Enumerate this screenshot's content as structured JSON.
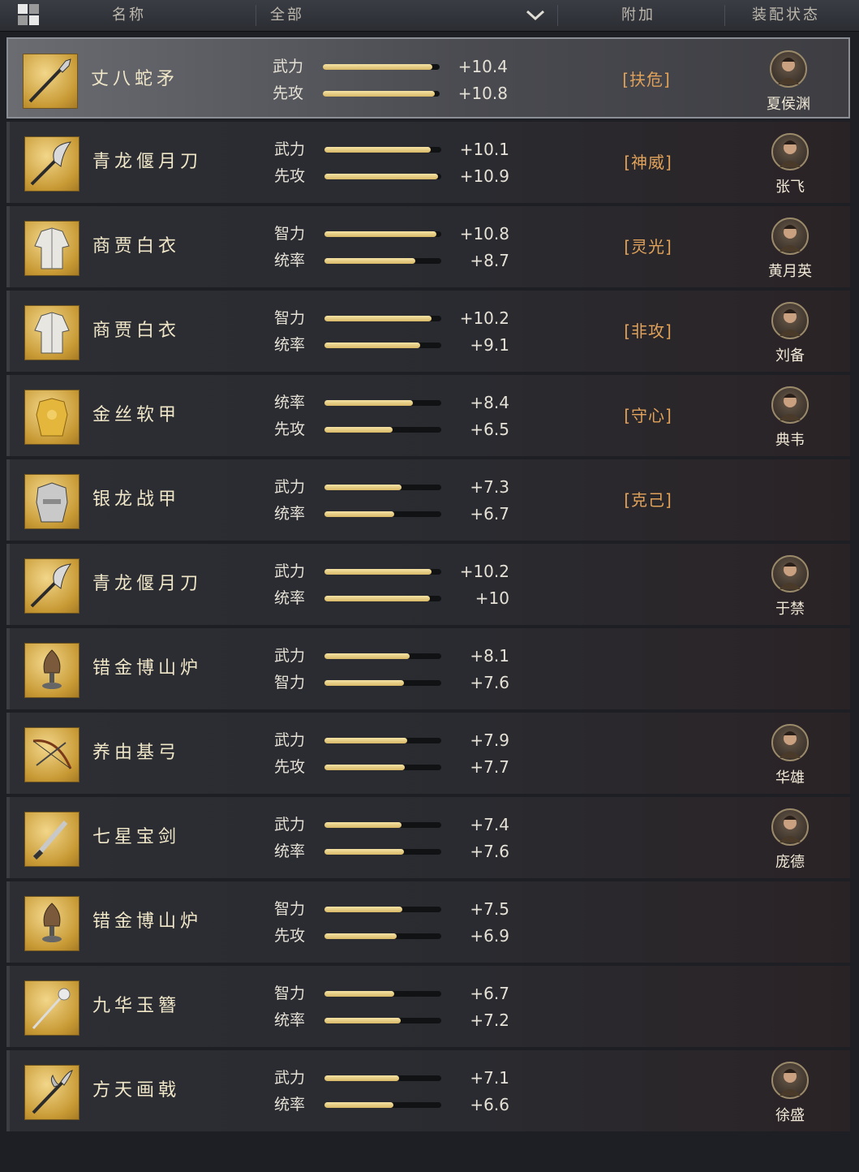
{
  "header": {
    "name_label": "名称",
    "filter_value": "全部",
    "bonus_label": "附加",
    "status_label": "装配状态"
  },
  "colors": {
    "accent_gold": "#d8b866",
    "bonus_orange": "#e0a25a",
    "row_bg": "#2c2e34",
    "selected_bg": "#6a6c72"
  },
  "items": [
    {
      "name": "丈八蛇矛",
      "icon": "serpent-spear-icon",
      "stats": [
        {
          "label": "武力",
          "value": "+10.4",
          "fill": 0.94
        },
        {
          "label": "先攻",
          "value": "+10.8",
          "fill": 0.96
        }
      ],
      "bonus": "[扶危]",
      "hero": "夏侯渊",
      "selected": true
    },
    {
      "name": "青龙偃月刀",
      "icon": "crescent-blade-icon",
      "stats": [
        {
          "label": "武力",
          "value": "+10.1",
          "fill": 0.91
        },
        {
          "label": "先攻",
          "value": "+10.9",
          "fill": 0.97
        }
      ],
      "bonus": "[神威]",
      "hero": "张飞",
      "selected": false
    },
    {
      "name": "商贾白衣",
      "icon": "white-robe-icon",
      "stats": [
        {
          "label": "智力",
          "value": "+10.8",
          "fill": 0.96
        },
        {
          "label": "统率",
          "value": "+8.7",
          "fill": 0.78
        }
      ],
      "bonus": "[灵光]",
      "hero": "黄月英",
      "selected": false
    },
    {
      "name": "商贾白衣",
      "icon": "white-robe-icon",
      "stats": [
        {
          "label": "智力",
          "value": "+10.2",
          "fill": 0.92
        },
        {
          "label": "统率",
          "value": "+9.1",
          "fill": 0.82
        }
      ],
      "bonus": "[非攻]",
      "hero": "刘备",
      "selected": false
    },
    {
      "name": "金丝软甲",
      "icon": "gold-armor-icon",
      "stats": [
        {
          "label": "统率",
          "value": "+8.4",
          "fill": 0.76
        },
        {
          "label": "先攻",
          "value": "+6.5",
          "fill": 0.58
        }
      ],
      "bonus": "[守心]",
      "hero": "典韦",
      "selected": false
    },
    {
      "name": "银龙战甲",
      "icon": "silver-armor-icon",
      "stats": [
        {
          "label": "武力",
          "value": "+7.3",
          "fill": 0.66
        },
        {
          "label": "统率",
          "value": "+6.7",
          "fill": 0.6
        }
      ],
      "bonus": "[克己]",
      "hero": "",
      "selected": false
    },
    {
      "name": "青龙偃月刀",
      "icon": "crescent-blade-icon",
      "stats": [
        {
          "label": "武力",
          "value": "+10.2",
          "fill": 0.92
        },
        {
          "label": "统率",
          "value": "+10",
          "fill": 0.9
        }
      ],
      "bonus": "",
      "hero": "于禁",
      "selected": false
    },
    {
      "name": "错金博山炉",
      "icon": "incense-burner-icon",
      "stats": [
        {
          "label": "武力",
          "value": "+8.1",
          "fill": 0.73
        },
        {
          "label": "智力",
          "value": "+7.6",
          "fill": 0.68
        }
      ],
      "bonus": "",
      "hero": "",
      "selected": false
    },
    {
      "name": "养由基弓",
      "icon": "bow-icon",
      "stats": [
        {
          "label": "武力",
          "value": "+7.9",
          "fill": 0.71
        },
        {
          "label": "先攻",
          "value": "+7.7",
          "fill": 0.69
        }
      ],
      "bonus": "",
      "hero": "华雄",
      "selected": false
    },
    {
      "name": "七星宝剑",
      "icon": "sword-icon",
      "stats": [
        {
          "label": "武力",
          "value": "+7.4",
          "fill": 0.66
        },
        {
          "label": "统率",
          "value": "+7.6",
          "fill": 0.68
        }
      ],
      "bonus": "",
      "hero": "庞德",
      "selected": false
    },
    {
      "name": "错金博山炉",
      "icon": "incense-burner-icon",
      "stats": [
        {
          "label": "智力",
          "value": "+7.5",
          "fill": 0.67
        },
        {
          "label": "先攻",
          "value": "+6.9",
          "fill": 0.62
        }
      ],
      "bonus": "",
      "hero": "",
      "selected": false
    },
    {
      "name": "九华玉簪",
      "icon": "jade-hairpin-icon",
      "stats": [
        {
          "label": "智力",
          "value": "+6.7",
          "fill": 0.6
        },
        {
          "label": "统率",
          "value": "+7.2",
          "fill": 0.65
        }
      ],
      "bonus": "",
      "hero": "",
      "selected": false
    },
    {
      "name": "方天画戟",
      "icon": "halberd-icon",
      "stats": [
        {
          "label": "武力",
          "value": "+7.1",
          "fill": 0.64
        },
        {
          "label": "统率",
          "value": "+6.6",
          "fill": 0.59
        }
      ],
      "bonus": "",
      "hero": "徐盛",
      "selected": false
    }
  ]
}
